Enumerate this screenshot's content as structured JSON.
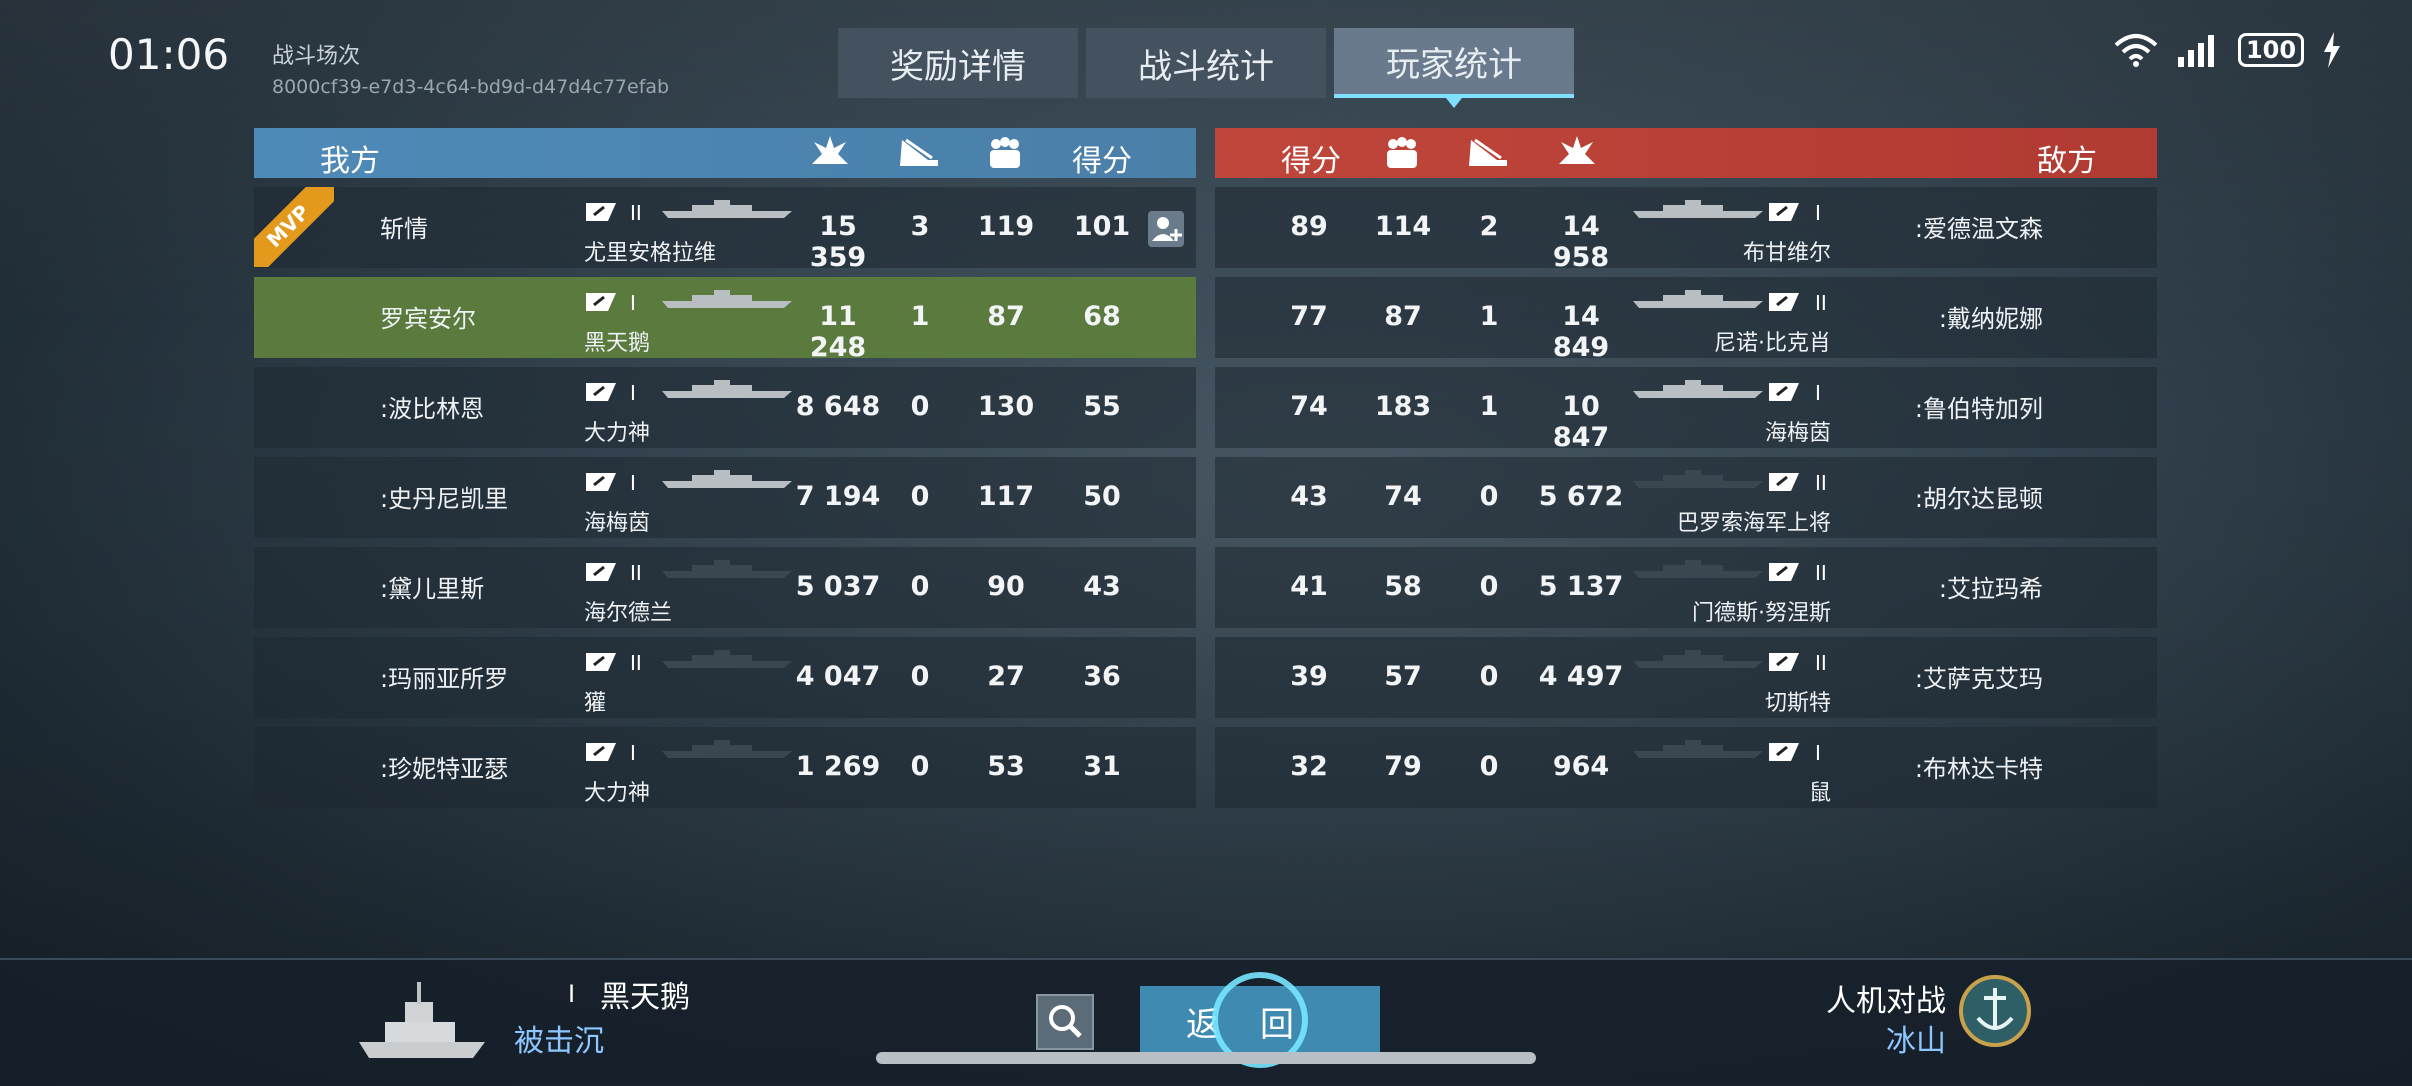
{
  "status_bar": {
    "time": "01:06",
    "battery": "100"
  },
  "battle": {
    "label": "战斗场次",
    "id": "8000cf39-e7d3-4c64-bd9d-d47d4c77efab"
  },
  "tabs": [
    {
      "label": "奖励详情"
    },
    {
      "label": "战斗统计"
    },
    {
      "label": "玩家统计"
    }
  ],
  "ally": {
    "title": "我方",
    "score_header": "得分",
    "rows": [
      {
        "player": "斩情",
        "ship": "尤里安格拉维",
        "tier": "II",
        "damage": "15 359",
        "kills": "3",
        "assists": "119",
        "score": "101"
      },
      {
        "player": "罗宾安尔",
        "ship": "黑天鹅",
        "tier": "I",
        "damage": "11 248",
        "kills": "1",
        "assists": "87",
        "score": "68"
      },
      {
        "player": ":波比林恩",
        "ship": "大力神",
        "tier": "I",
        "damage": "8 648",
        "kills": "0",
        "assists": "130",
        "score": "55"
      },
      {
        "player": ":史丹尼凯里",
        "ship": "海梅茵",
        "tier": "I",
        "damage": "7 194",
        "kills": "0",
        "assists": "117",
        "score": "50"
      },
      {
        "player": ":黛儿里斯",
        "ship": "海尔德兰",
        "tier": "II",
        "damage": "5 037",
        "kills": "0",
        "assists": "90",
        "score": "43"
      },
      {
        "player": ":玛丽亚所罗",
        "ship": "獾",
        "tier": "II",
        "damage": "4 047",
        "kills": "0",
        "assists": "27",
        "score": "36"
      },
      {
        "player": ":珍妮特亚瑟",
        "ship": "大力神",
        "tier": "I",
        "damage": "1 269",
        "kills": "0",
        "assists": "53",
        "score": "31"
      }
    ]
  },
  "enemy": {
    "title": "敌方",
    "score_header": "得分",
    "rows": [
      {
        "player": ":爱德温文森",
        "ship": "布甘维尔",
        "tier": "I",
        "damage": "14 958",
        "kills": "2",
        "assists": "114",
        "score": "89"
      },
      {
        "player": ":戴纳妮娜",
        "ship": "尼诺·比克肖",
        "tier": "II",
        "damage": "14 849",
        "kills": "1",
        "assists": "87",
        "score": "77"
      },
      {
        "player": ":鲁伯特加列",
        "ship": "海梅茵",
        "tier": "I",
        "damage": "10 847",
        "kills": "1",
        "assists": "183",
        "score": "74"
      },
      {
        "player": ":胡尔达昆顿",
        "ship": "巴罗索海军上将",
        "tier": "II",
        "damage": "5 672",
        "kills": "0",
        "assists": "74",
        "score": "43"
      },
      {
        "player": ":艾拉玛希",
        "ship": "门德斯·努涅斯",
        "tier": "II",
        "damage": "5 137",
        "kills": "0",
        "assists": "58",
        "score": "41"
      },
      {
        "player": ":艾萨克艾玛",
        "ship": "切斯特",
        "tier": "II",
        "damage": "4 497",
        "kills": "0",
        "assists": "57",
        "score": "39"
      },
      {
        "player": ":布林达卡特",
        "ship": "鼠",
        "tier": "I",
        "damage": "964",
        "kills": "0",
        "assists": "79",
        "score": "32"
      }
    ]
  },
  "mvp_label": "MVP",
  "footer": {
    "self_tier": "I",
    "self_ship": "黑天鹅",
    "self_status": "被击沉",
    "return_label": "返回",
    "mode": "人机对战",
    "map": "冰山"
  },
  "colors": {
    "ally_header": "#4e8ab8",
    "enemy_header": "#c0463b",
    "highlight_row": "#5a7a3e",
    "mvp": "#e39a1c",
    "accent": "#7fe0ff"
  }
}
